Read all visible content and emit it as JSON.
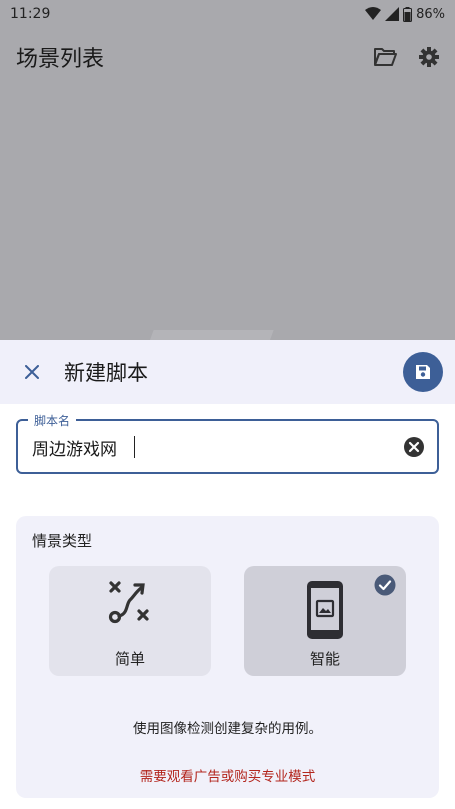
{
  "status": {
    "time": "11:29",
    "battery": "86%"
  },
  "app_bar": {
    "title": "场景列表"
  },
  "sheet": {
    "title": "新建脚本",
    "field": {
      "label": "脚本名",
      "value": "周边游戏网"
    },
    "card": {
      "title": "情景类型",
      "options": [
        {
          "label": "简单",
          "selected": false
        },
        {
          "label": "智能",
          "selected": true
        }
      ],
      "description": "使用图像检测创建复杂的用例。",
      "warning": "需要观看广告或购买专业模式"
    }
  },
  "colors": {
    "accent": "#3d5f97",
    "warning": "#b3261e",
    "sheet_header": "#f0f0fa"
  }
}
